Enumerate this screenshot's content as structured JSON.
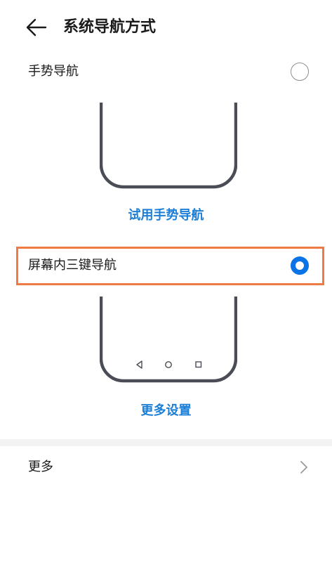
{
  "header": {
    "title": "系统导航方式",
    "back_icon": "arrow-left-icon"
  },
  "options": {
    "gesture": {
      "label": "手势导航",
      "selected": false,
      "link": "试用手势导航"
    },
    "three_key": {
      "label": "屏幕内三键导航",
      "selected": true,
      "link": "更多设置"
    }
  },
  "more": {
    "label": "更多",
    "icon": "chevron-right-icon"
  },
  "colors": {
    "accent": "#0a73e6",
    "link": "#1b7fd8",
    "highlight": "#ee7a44",
    "phone_frame": "#4a4d55"
  }
}
